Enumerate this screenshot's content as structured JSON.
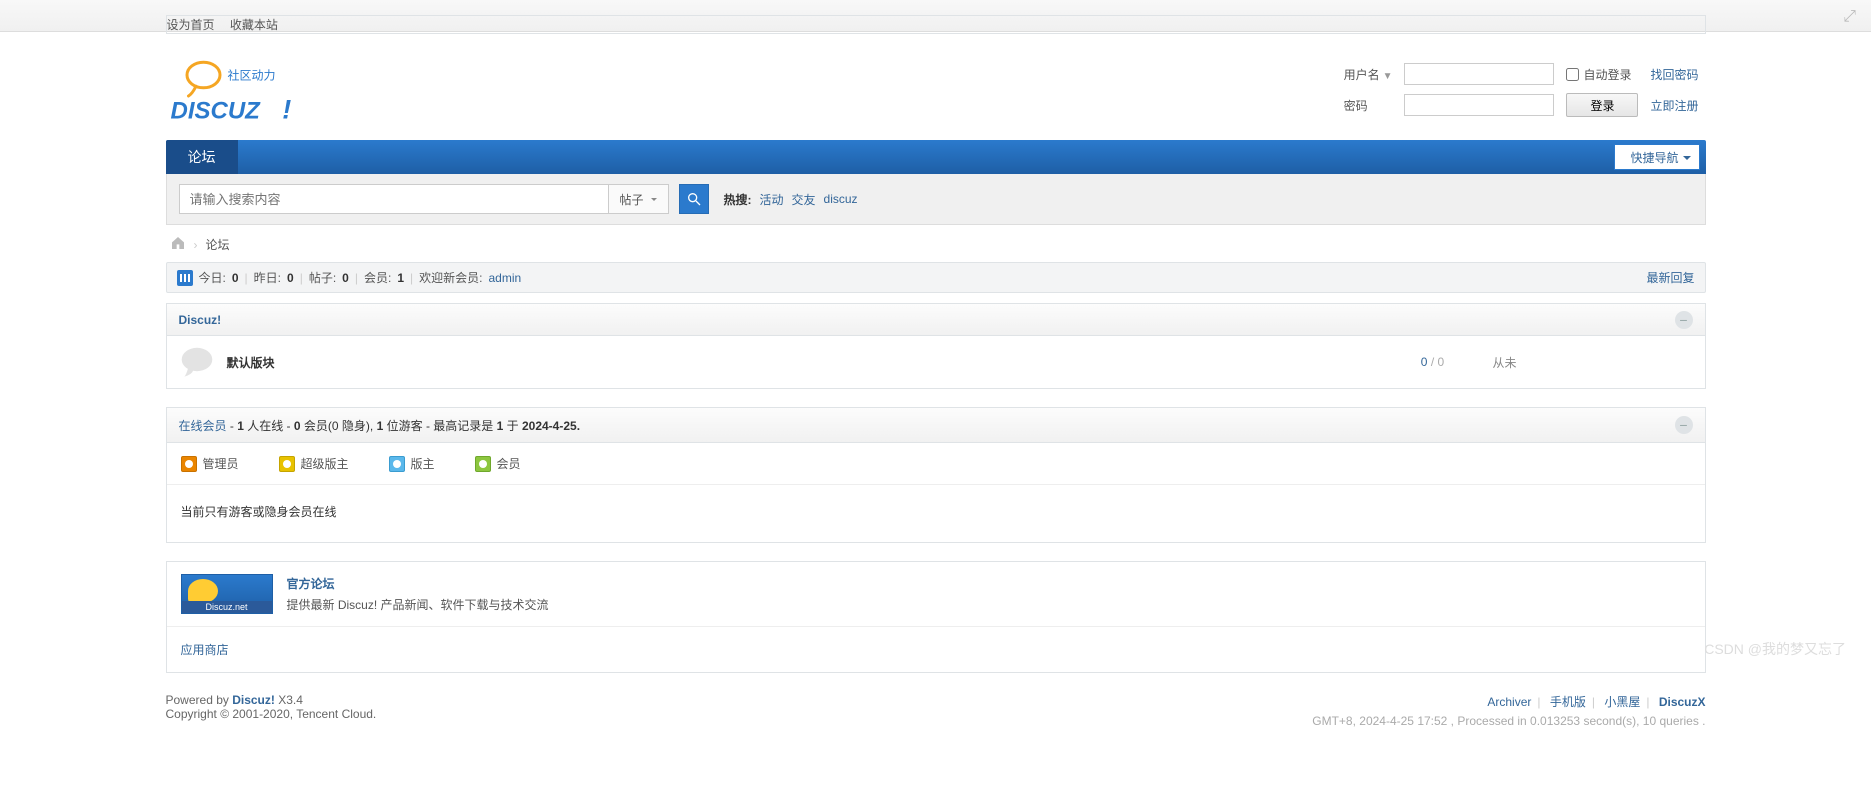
{
  "top": {
    "set_home": "设为首页",
    "favorite": "收藏本站"
  },
  "login": {
    "user_label": "用户名",
    "pass_label": "密码",
    "auto_login": "自动登录",
    "find_pw": "找回密码",
    "login_btn": "登录",
    "register": "立即注册"
  },
  "nav": {
    "forum": "论坛",
    "quicknav": "快捷导航"
  },
  "search": {
    "placeholder": "请输入搜索内容",
    "type": "帖子",
    "hot_label": "热搜:",
    "hot": [
      "活动",
      "交友",
      "discuz"
    ]
  },
  "crumb": {
    "forum": "论坛"
  },
  "stats": {
    "today_label": "今日:",
    "today": "0",
    "yesterday_label": "昨日:",
    "yesterday": "0",
    "posts_label": "帖子:",
    "posts": "0",
    "members_label": "会员:",
    "members": "1",
    "welcome_label": "欢迎新会员:",
    "new_member": "admin",
    "latest_reply": "最新回复"
  },
  "category": {
    "name": "Discuz!",
    "forum": {
      "name": "默认版块",
      "topics": "0",
      "replies": "0",
      "last": "从未"
    }
  },
  "online": {
    "title_raw": "在线会员 - 1 人在线 - 0 会员(0 隐身), 1 位游客 - 最高记录是 1 于 2024-4-25.",
    "title_a": "在线会员",
    "title_b": " - ",
    "people": "1",
    "title_c": " 人在线 - ",
    "members_n": "0",
    "title_d": " 会员(",
    "hidden_n": "0",
    "title_e": " 隐身), ",
    "guests_n": "1",
    "title_f": " 位游客 - 最高记录是 ",
    "max_n": "1",
    "title_g": " 于 ",
    "max_date": "2024-4-25.",
    "legend": {
      "admin": "管理员",
      "smod": "超级版主",
      "mod": "版主",
      "member": "会员"
    },
    "msg": "当前只有游客或隐身会员在线"
  },
  "linksblock": {
    "official_title": "官方论坛",
    "official_desc": "提供最新 Discuz! 产品新闻、软件下载与技术交流",
    "appstore": "应用商店"
  },
  "footer": {
    "powered_a": "Powered by ",
    "product": "Discuz!",
    "version": " X3.4",
    "copyright": "Copyright © 2001-2020, Tencent Cloud.",
    "archiver": "Archiver",
    "mobile": "手机版",
    "blackroom": "小黑屋",
    "brand": "DiscuzX",
    "meta": "GMT+8, 2024-4-25 17:52 , Processed in 0.013253 second(s), 10 queries ."
  },
  "watermark": "CSDN @我的梦又忘了"
}
